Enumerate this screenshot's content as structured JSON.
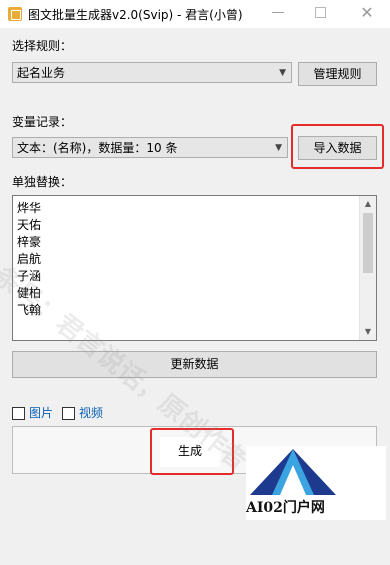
{
  "window": {
    "title": "图文批量生成器v2.0(Svip) - 君言(小曾)",
    "minimize": "—",
    "close": "✕"
  },
  "rules": {
    "label": "选择规则：",
    "selected": "起名业务",
    "manage_button": "管理规则"
  },
  "variables": {
    "label": "变量记录：",
    "selected": "文本：(名称)，数据量：10 条",
    "import_button": "导入数据"
  },
  "replace": {
    "label": "单独替换：",
    "items": [
      "烨华",
      "天佑",
      "梓豪",
      "启航",
      "子涵",
      "健柏",
      "飞翰"
    ]
  },
  "update_button": "更新数据",
  "options": {
    "image_label": "图片",
    "video_label": "视频",
    "image_checked": false,
    "video_checked": false
  },
  "generate_button": "生成",
  "watermark": "头条号：君言说话，原创作者",
  "logo": {
    "text": "AI02门户网",
    "color_dark": "#1d3a8f",
    "color_light": "#3aa3e0"
  },
  "colors": {
    "highlight": "#e52b2b",
    "checkbox_label": "#0a5fb4"
  }
}
